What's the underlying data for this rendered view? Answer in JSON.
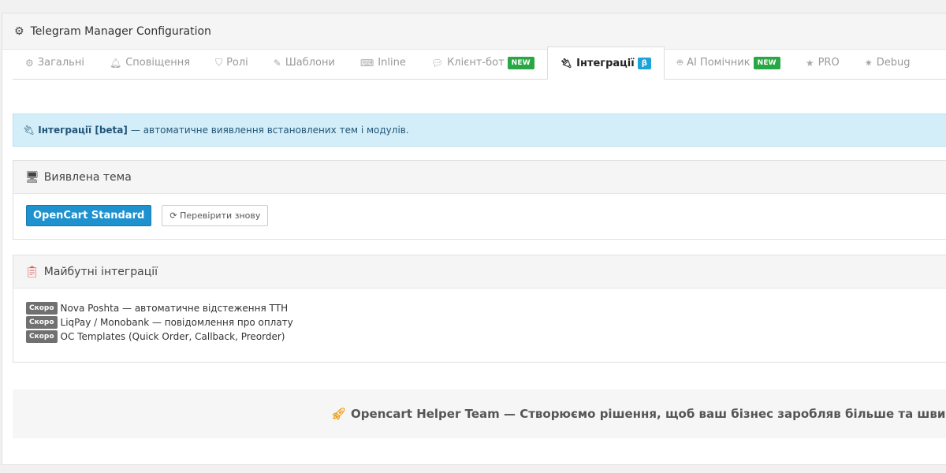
{
  "header": {
    "title": "Telegram Manager Configuration"
  },
  "tabs": [
    {
      "label": "Загальні",
      "icon": "gear-icon"
    },
    {
      "label": "Сповіщення",
      "icon": "bell-icon"
    },
    {
      "label": "Ролі",
      "icon": "shield-icon"
    },
    {
      "label": "Шаблони",
      "icon": "edit-icon"
    },
    {
      "label": "Inline",
      "icon": "keyboard-icon"
    },
    {
      "label": "Клієнт-бот",
      "icon": "comments-icon",
      "badge": "NEW"
    },
    {
      "label": "Інтеграції",
      "icon": "plug-icon",
      "badge": "β",
      "active": true
    },
    {
      "label": "AI Помічник",
      "icon": "android-icon",
      "badge": "NEW"
    },
    {
      "label": "PRO",
      "icon": "star-icon"
    },
    {
      "label": "Debug",
      "icon": "bug-icon"
    }
  ],
  "alert": {
    "title": "Інтеграції [beta]",
    "text": "— автоматичне виявлення встановлених тем і модулів."
  },
  "theme_box": {
    "title": "Виявлена тема",
    "theme_button": "OpenCart Standard",
    "recheck_button": "Перевірити знову"
  },
  "future_box": {
    "title": "Майбутні інтеграції",
    "items": [
      {
        "badge": "Скоро",
        "text": "Nova Poshta — автоматичне відстеження ТТН"
      },
      {
        "badge": "Скоро",
        "text": "LiqPay / Monobank — повідомлення про оплату"
      },
      {
        "badge": "Скоро",
        "text": "OC Templates (Quick Order, Callback, Preorder)"
      }
    ]
  },
  "footer": {
    "text": "Opencart Helper Team — Створюємо рішення, щоб ваш бізнес заробляв більше та швидше"
  },
  "colors": {
    "primary": "#1e91cf",
    "new_badge": "#28a745",
    "beta_badge": "#1ea3d9",
    "alert_bg": "#d3eef8"
  }
}
